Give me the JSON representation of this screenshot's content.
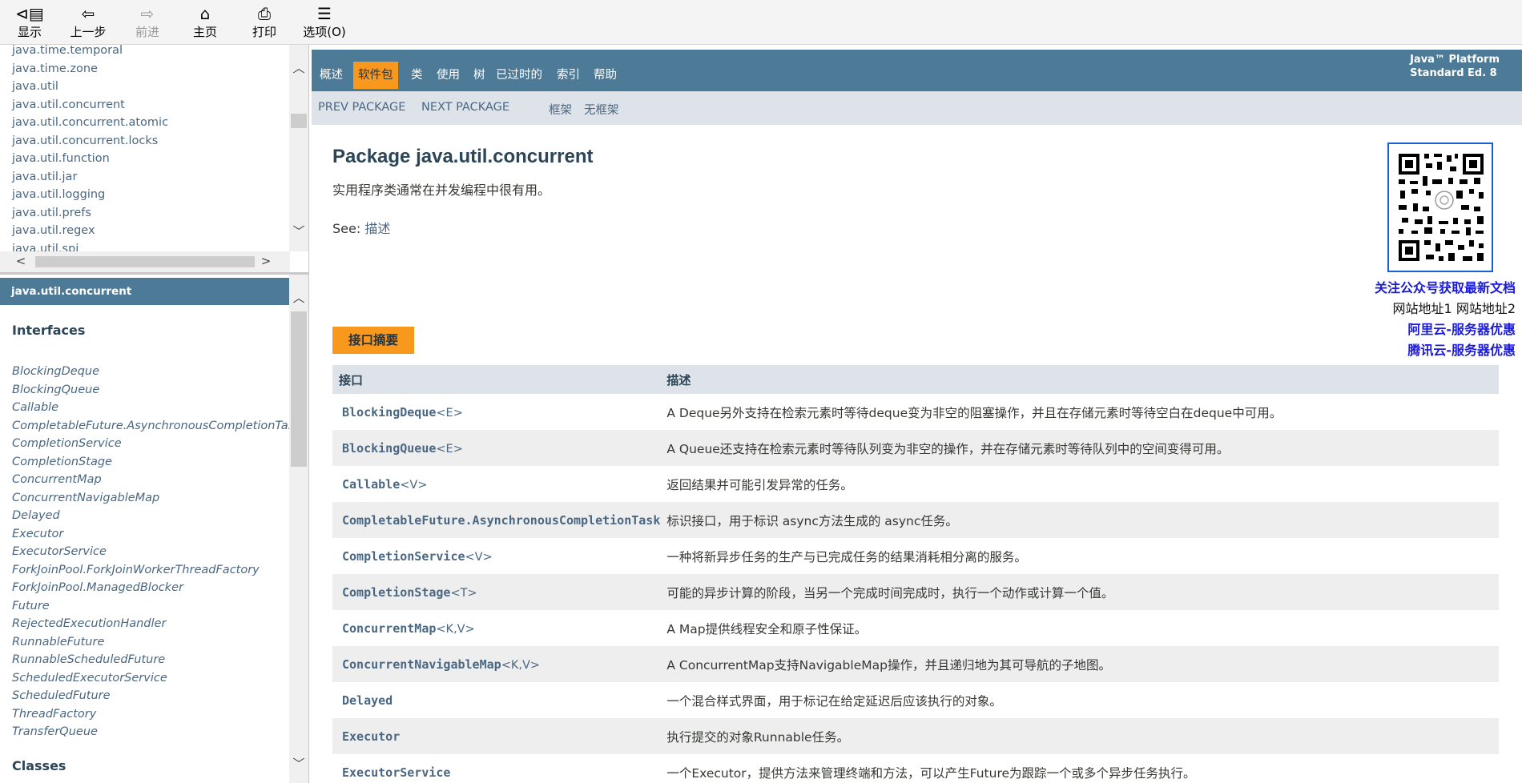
{
  "toolbar": {
    "buttons": [
      {
        "label": "显示",
        "icon": "show-icon"
      },
      {
        "label": "上一步",
        "icon": "back-arrow-icon"
      },
      {
        "label": "前进",
        "icon": "forward-arrow-icon"
      },
      {
        "label": "主页",
        "icon": "home-icon"
      },
      {
        "label": "打印",
        "icon": "printer-icon"
      },
      {
        "label": "选项(O)",
        "icon": "options-icon"
      }
    ]
  },
  "package_frame": {
    "items": [
      "java.time.temporal",
      "java.time.zone",
      "java.util",
      "java.util.concurrent",
      "java.util.concurrent.atomic",
      "java.util.concurrent.locks",
      "java.util.function",
      "java.util.jar",
      "java.util.logging",
      "java.util.prefs",
      "java.util.regex",
      "java.util.spi"
    ]
  },
  "class_frame": {
    "header": "java.util.concurrent",
    "interfaces_title": "Interfaces",
    "classes_title": "Classes",
    "interfaces": [
      "BlockingDeque",
      "BlockingQueue",
      "Callable",
      "CompletableFuture.AsynchronousCompletionTask",
      "CompletionService",
      "CompletionStage",
      "ConcurrentMap",
      "ConcurrentNavigableMap",
      "Delayed",
      "Executor",
      "ExecutorService",
      "ForkJoinPool.ForkJoinWorkerThreadFactory",
      "ForkJoinPool.ManagedBlocker",
      "Future",
      "RejectedExecutionHandler",
      "RunnableFuture",
      "RunnableScheduledFuture",
      "ScheduledExecutorService",
      "ScheduledFuture",
      "ThreadFactory",
      "TransferQueue"
    ]
  },
  "nav": {
    "items": [
      "概述",
      "软件包",
      "类",
      "使用",
      "树",
      "已过时的",
      "索引",
      "帮助"
    ],
    "active_index": 1,
    "about_line1": "Java™ Platform",
    "about_line2": "Standard Ed. 8",
    "prev_package": "PREV PACKAGE",
    "next_package": "NEXT PACKAGE",
    "frames": "框架",
    "no_frames": "无框架"
  },
  "content": {
    "title": "Package java.util.concurrent",
    "description": "实用程序类通常在并发编程中很有用。",
    "see_label": "See: ",
    "see_link": "描述"
  },
  "ads": {
    "follow": "关注公众号获取最新文档",
    "site1": "网站地址1",
    "site2": "网站地址2",
    "aliyun": "阿里云-服务器优惠",
    "tencent": "腾讯云-服务器优惠"
  },
  "summary": {
    "caption": "接口摘要",
    "col_interface": "接口",
    "col_description": "描述",
    "rows": [
      {
        "name": "BlockingDeque",
        "generic": "<E>",
        "desc": "A Deque另外支持在检索元素时等待deque变为非空的阻塞操作，并且在存储元素时等待空白在deque中可用。"
      },
      {
        "name": "BlockingQueue",
        "generic": "<E>",
        "desc": "A Queue还支持在检索元素时等待队列变为非空的操作，并在存储元素时等待队列中的空间变得可用。"
      },
      {
        "name": "Callable",
        "generic": "<V>",
        "desc": "返回结果并可能引发异常的任务。"
      },
      {
        "name": "CompletableFuture.AsynchronousCompletionTask",
        "generic": "",
        "desc": "标识接口，用于标识 async方法生成的 async任务。"
      },
      {
        "name": "CompletionService",
        "generic": "<V>",
        "desc": "一种将新异步任务的生产与已完成任务的结果消耗相分离的服务。"
      },
      {
        "name": "CompletionStage",
        "generic": "<T>",
        "desc": "可能的异步计算的阶段，当另一个完成时间完成时，执行一个动作或计算一个值。"
      },
      {
        "name": "ConcurrentMap",
        "generic": "<K,V>",
        "desc": "A Map提供线程安全和原子性保证。"
      },
      {
        "name": "ConcurrentNavigableMap",
        "generic": "<K,V>",
        "desc": "A ConcurrentMap支持NavigableMap操作，并且递归地为其可导航的子地图。"
      },
      {
        "name": "Delayed",
        "generic": "",
        "desc": "一个混合样式界面，用于标记在给定延迟后应该执行的对象。"
      },
      {
        "name": "Executor",
        "generic": "",
        "desc": "执行提交的对象Runnable任务。"
      },
      {
        "name": "ExecutorService",
        "generic": "",
        "desc": "一个Executor，提供方法来管理终端和方法，可以产生Future为跟踪一个或多个异步任务执行。"
      }
    ]
  },
  "colors": {
    "nav_bg": "#4d7a97",
    "active": "#f8981d",
    "subnav_bg": "#dee3e9",
    "link": "#4a6782",
    "ad_blue": "#1b1bd6"
  }
}
